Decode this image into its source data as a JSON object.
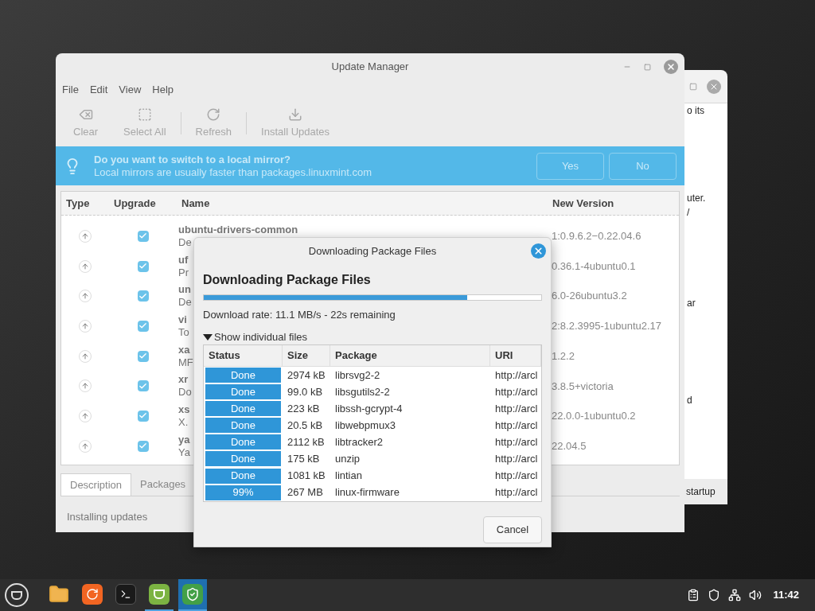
{
  "back_window": {
    "texts": [
      "o its",
      "uter.",
      "/",
      "ar",
      "d",
      "startup"
    ]
  },
  "main_window": {
    "title": "Update Manager",
    "menu": [
      "File",
      "Edit",
      "View",
      "Help"
    ],
    "toolbar": [
      {
        "kind": "clear",
        "label": "Clear",
        "disabled": true
      },
      {
        "kind": "select",
        "label": "Select All",
        "disabled": true
      },
      {
        "kind": "refresh",
        "label": "Refresh",
        "disabled": true
      },
      {
        "kind": "install",
        "label": "Install Updates",
        "disabled": true
      }
    ],
    "infobar": {
      "title": "Do you want to switch to a local mirror?",
      "message": "Local mirrors are usually faster than packages.linuxmint.com",
      "buttons": [
        "Yes",
        "No"
      ]
    },
    "table": {
      "columns": [
        "Type",
        "Upgrade",
        "Name",
        "New Version"
      ],
      "rows": [
        {
          "name": "ubuntu-drivers-common",
          "description": "De",
          "new_version": "1:0.9.6.2−0.22.04.6",
          "checked": true
        },
        {
          "name": "uf",
          "description": "Pr",
          "new_version": "0.36.1-4ubuntu0.1",
          "checked": true
        },
        {
          "name": "un",
          "description": "De",
          "new_version": "6.0-26ubuntu3.2",
          "checked": true
        },
        {
          "name": "vi",
          "description": "To",
          "new_version": "2:8.2.3995-1ubuntu2.17",
          "checked": true
        },
        {
          "name": "xa",
          "description": "MF",
          "new_version": "1.2.2",
          "checked": true
        },
        {
          "name": "xr",
          "description": "Do",
          "new_version": "3.8.5+victoria",
          "checked": true
        },
        {
          "name": "xs",
          "description": "X.",
          "new_version": "22.0.0-1ubuntu0.2",
          "checked": true
        },
        {
          "name": "ya",
          "description": "Ya",
          "new_version": "22.04.5",
          "checked": true
        }
      ]
    },
    "tabs": [
      {
        "label": "Description",
        "selected": true
      },
      {
        "label": "Packages",
        "selected": false
      }
    ],
    "status": "Installing updates"
  },
  "dialog": {
    "title": "Downloading Package Files",
    "heading": "Downloading Package Files",
    "progress": {
      "level": 0.78
    },
    "rate": "Download rate: 11.1 MB/s - 22s remaining",
    "expander": {
      "label": "Show individual files",
      "expanded": true
    },
    "files": {
      "columns": [
        "Status",
        "Size",
        "Package",
        "URI"
      ],
      "rows": [
        {
          "status": "Done",
          "size": "2974 kB",
          "package": "librsvg2-2",
          "uri": "http://arcl"
        },
        {
          "status": "Done",
          "size": "99.0 kB",
          "package": "libsgutils2-2",
          "uri": "http://arcl"
        },
        {
          "status": "Done",
          "size": "223 kB",
          "package": "libssh-gcrypt-4",
          "uri": "http://arcl"
        },
        {
          "status": "Done",
          "size": "20.5 kB",
          "package": "libwebpmux3",
          "uri": "http://arcl"
        },
        {
          "status": "Done",
          "size": "2112 kB",
          "package": "libtracker2",
          "uri": "http://arcl"
        },
        {
          "status": "Done",
          "size": "175 kB",
          "package": "unzip",
          "uri": "http://arcl"
        },
        {
          "status": "Done",
          "size": "1081 kB",
          "package": "lintian",
          "uri": "http://arcl"
        },
        {
          "status": "99%",
          "size": "267 MB",
          "package": "linux-firmware",
          "uri": "http://arcl"
        }
      ]
    },
    "buttons": [
      "Cancel"
    ]
  },
  "taskbar": {
    "apps": [
      {
        "kind": "files",
        "running": false,
        "selected": false
      },
      {
        "kind": "browser",
        "running": false,
        "selected": false
      },
      {
        "kind": "terminal",
        "running": false,
        "selected": false
      },
      {
        "kind": "updater",
        "running": true,
        "selected": false
      },
      {
        "kind": "shield",
        "running": true,
        "selected": true
      }
    ],
    "clock": "11:42"
  }
}
